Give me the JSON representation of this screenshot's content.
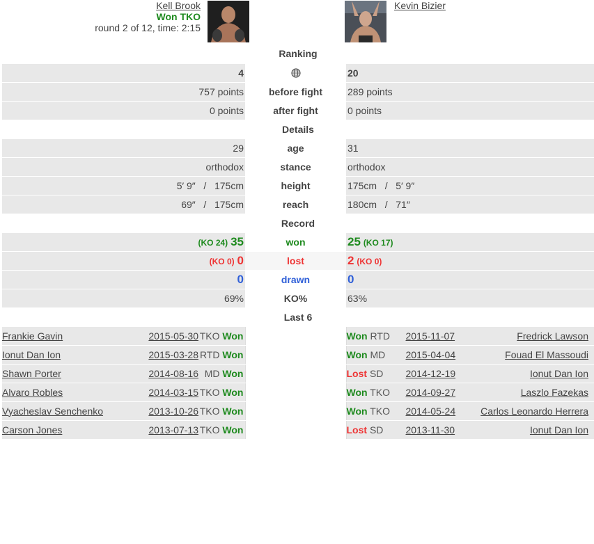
{
  "fighter_a": {
    "name": "Kell Brook",
    "result": "Won TKO",
    "round_info": "round 2 of 12, time: 2:15"
  },
  "fighter_b": {
    "name": "Kevin Bizier"
  },
  "sections": {
    "ranking": "Ranking",
    "details": "Details",
    "record": "Record",
    "last6": "Last 6"
  },
  "ranking": {
    "a_rank": "4",
    "b_rank": "20",
    "icon": "globe-icon",
    "before_label": "before fight",
    "a_before": "757 points",
    "b_before": "289 points",
    "after_label": "after fight",
    "a_after": "0 points",
    "b_after": "0 points"
  },
  "details": {
    "age": {
      "label": "age",
      "a": "29",
      "b": "31"
    },
    "stance": {
      "label": "stance",
      "a": "orthodox",
      "b": "orthodox"
    },
    "height": {
      "label": "height",
      "a": "5′ 9″   /   175cm",
      "b": "175cm   /   5′ 9″"
    },
    "reach": {
      "label": "reach",
      "a": "69″   /   175cm",
      "b": "180cm   /   71″"
    }
  },
  "record": {
    "won": {
      "label": "won",
      "a": "35",
      "a_ko": "(KO 24)",
      "b": "25",
      "b_ko": "(KO 17)"
    },
    "lost": {
      "label": "lost",
      "a": "0",
      "a_ko": "(KO 0)",
      "b": "2",
      "b_ko": "(KO 0)"
    },
    "drawn": {
      "label": "drawn",
      "a": "0",
      "b": "0"
    },
    "kopct": {
      "label": "KO%",
      "a": "69%",
      "b": "63%"
    }
  },
  "last6_a": [
    {
      "opponent": "Frankie Gavin",
      "date": "2015-05-30",
      "method": "TKO",
      "result": "Won"
    },
    {
      "opponent": "Ionut Dan Ion",
      "date": "2015-03-28",
      "method": "RTD",
      "result": "Won"
    },
    {
      "opponent": "Shawn Porter",
      "date": "2014-08-16",
      "method": "MD",
      "result": "Won"
    },
    {
      "opponent": "Alvaro Robles",
      "date": "2014-03-15",
      "method": "TKO",
      "result": "Won"
    },
    {
      "opponent": "Vyacheslav Senchenko",
      "date": "2013-10-26",
      "method": "TKO",
      "result": "Won"
    },
    {
      "opponent": "Carson Jones",
      "date": "2013-07-13",
      "method": "TKO",
      "result": "Won"
    }
  ],
  "last6_b": [
    {
      "opponent": "Fredrick Lawson",
      "date": "2015-11-07",
      "method": "RTD",
      "result": "Won"
    },
    {
      "opponent": "Fouad El Massoudi",
      "date": "2015-04-04",
      "method": "MD",
      "result": "Won"
    },
    {
      "opponent": "Ionut Dan Ion",
      "date": "2014-12-19",
      "method": "SD",
      "result": "Lost"
    },
    {
      "opponent": "Laszlo Fazekas",
      "date": "2014-09-27",
      "method": "TKO",
      "result": "Won"
    },
    {
      "opponent": "Carlos Leonardo Herrera",
      "date": "2014-05-24",
      "method": "TKO",
      "result": "Won"
    },
    {
      "opponent": "Ionut Dan Ion",
      "date": "2013-11-30",
      "method": "SD",
      "result": "Lost"
    }
  ],
  "colors": {
    "won": "#1e8a1e",
    "lost": "#ee3333",
    "drawn": "#2f5fd8",
    "row_bg": "#e8e8e8"
  }
}
